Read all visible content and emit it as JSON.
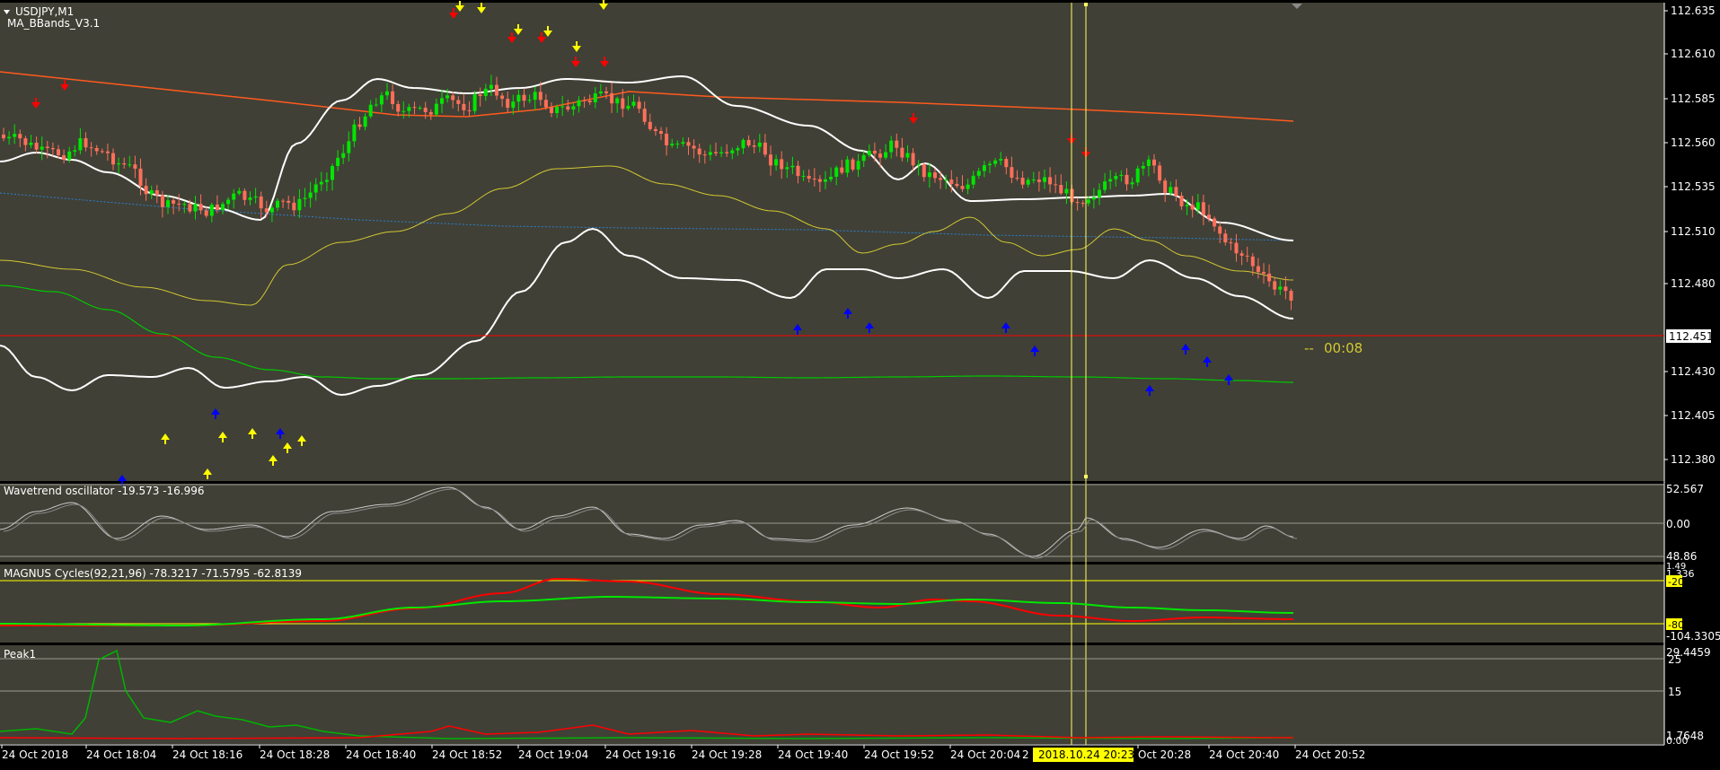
{
  "symbol": "USDJPY,M1",
  "indicator_main": "MA_BBands_V3.1",
  "countdown": "00:08",
  "current_price": "112.451",
  "price_axis": [
    "112.635",
    "112.610",
    "112.585",
    "112.560",
    "112.535",
    "112.510",
    "112.480",
    "112.430",
    "112.405",
    "112.380"
  ],
  "time_axis": [
    "24 Oct 2018",
    "24 Oct 18:04",
    "24 Oct 18:16",
    "24 Oct 18:28",
    "24 Oct 18:40",
    "24 Oct 18:52",
    "24 Oct 19:04",
    "24 Oct 19:16",
    "24 Oct 19:28",
    "24 Oct 19:40",
    "24 Oct 19:52",
    "24 Oct 20:04",
    "Oct 20:28",
    "24 Oct 20:40",
    "24 Oct 20:52"
  ],
  "crosshair_time_partial": "2",
  "crosshair_time": "2018.10.24 20:23",
  "panes": {
    "wavetrend": {
      "title": "Wavetrend oscillator -19.573 -16.996",
      "axis": {
        "top": "52.567",
        "zero": "0.00",
        "bottom": "48.86"
      }
    },
    "magnus": {
      "title": "MAGNUS Cycles(92,21,96) -78.3217 -71.5795 -62.8139",
      "axis": {
        "top_a": "1.49",
        "top_b": "1.336",
        "level_a": "-20",
        "level_b": "-80",
        "bottom": "-104.3305"
      }
    },
    "peak": {
      "title": "Peak1",
      "axis": {
        "top": "29.4459",
        "level_25": "25",
        "level_15": "15",
        "bottom_a": "1.7648",
        "bottom_b": "0.00"
      }
    }
  },
  "colors": {
    "background": "#000000",
    "pane": "#404036",
    "bull": "#00e600",
    "bear": "#ff6f5a",
    "band": "#ffffff",
    "ma_orange": "#ff5a1e",
    "ma_yellow": "#d2c832",
    "ma_green": "#00c800",
    "ma_blue": "#2c7fd0",
    "price_line": "#ff0000",
    "crosshair": "#ffff64",
    "arrow_up": "#0000ff",
    "arrow_down": "#ff0000",
    "arrow_yellow": "#ffff00"
  }
}
